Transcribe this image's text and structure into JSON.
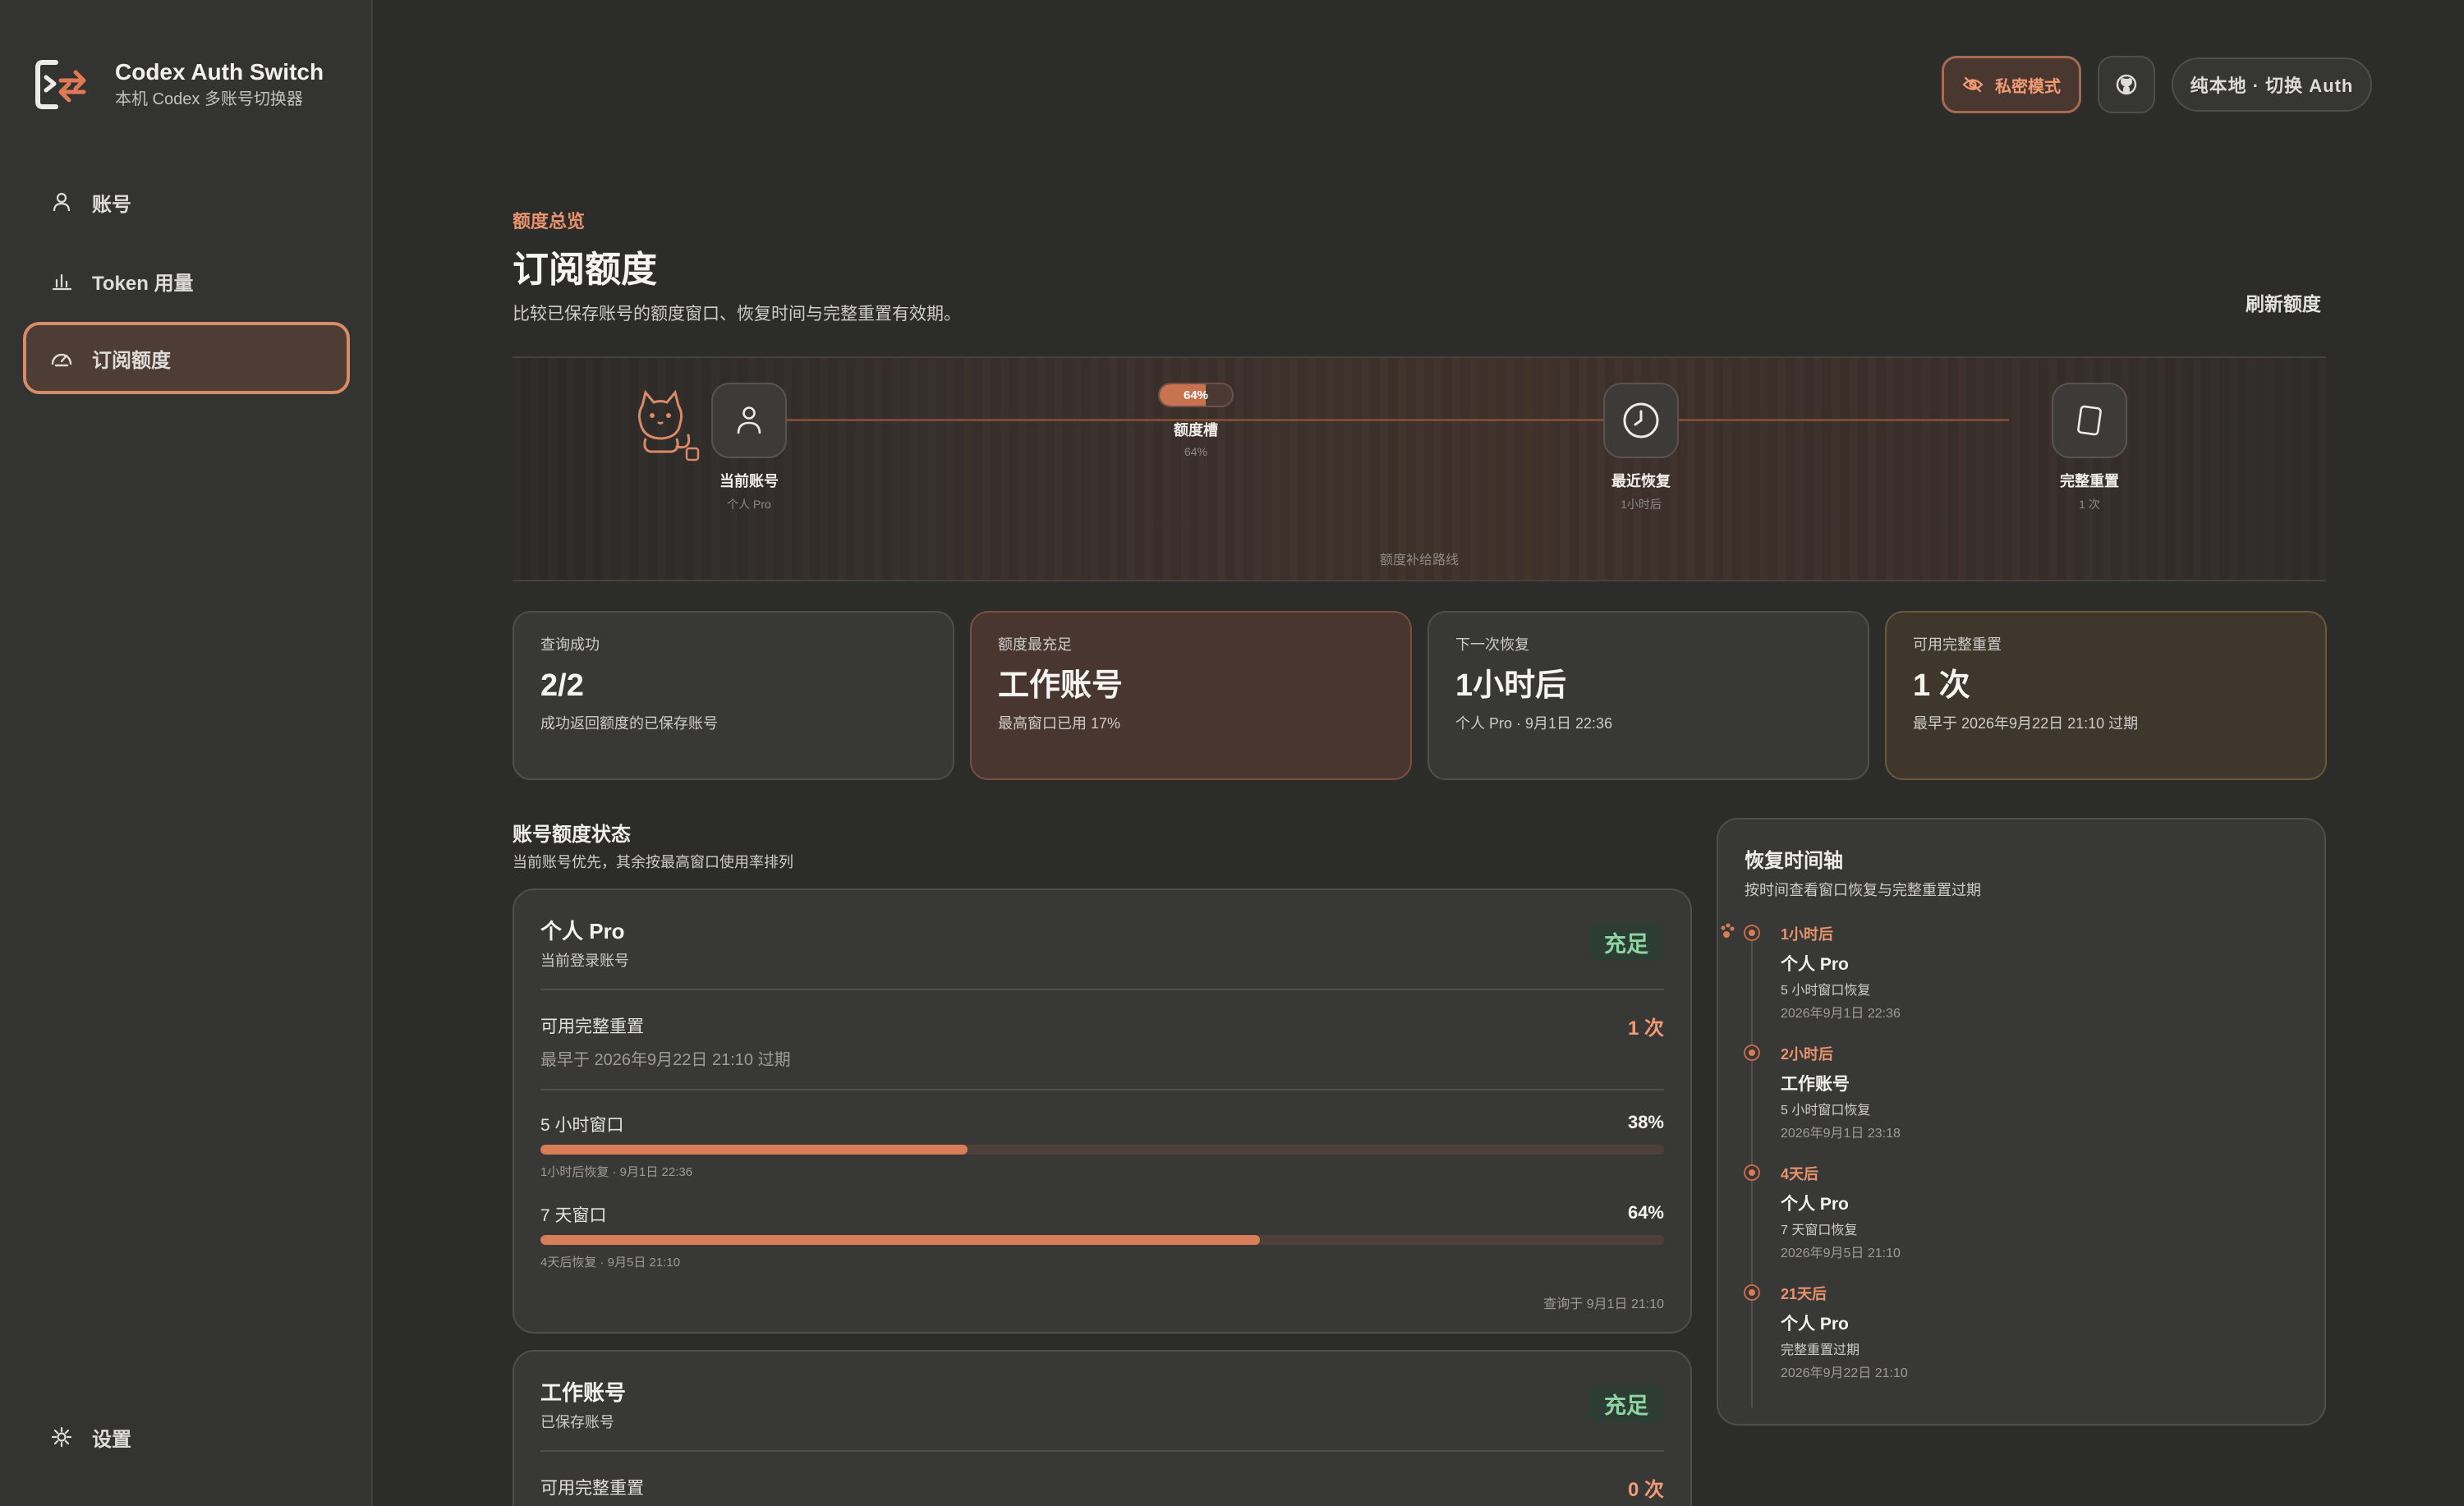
{
  "brand": {
    "title": "Codex Auth Switch",
    "subtitle": "本机 Codex 多账号切换器"
  },
  "nav": {
    "items": [
      {
        "label": "账号",
        "icon": "user-icon"
      },
      {
        "label": "Token 用量",
        "icon": "bar-chart-icon"
      },
      {
        "label": "订阅额度",
        "icon": "gauge-icon",
        "active": true
      }
    ],
    "settings_label": "设置"
  },
  "topbar": {
    "private_label": "私密模式",
    "local_label": "纯本地 · 切换 Auth"
  },
  "header": {
    "eyebrow": "额度总览",
    "title": "订阅额度",
    "description": "比较已保存账号的额度窗口、恢复时间与完整重置有效期。",
    "refresh_label": "刷新额度"
  },
  "route": {
    "caption": "额度补给路线",
    "nodes": [
      {
        "label": "当前账号",
        "sub": "个人 Pro",
        "icon": "user-icon"
      },
      {
        "label": "额度槽",
        "sub": "64%",
        "meter_text": "64%",
        "meter_fraction": 0.64
      },
      {
        "label": "最近恢复",
        "sub": "1小时后",
        "icon": "clock-icon"
      },
      {
        "label": "完整重置",
        "sub": "1 次",
        "icon": "card-icon"
      }
    ]
  },
  "stats": [
    {
      "label": "查询成功",
      "value": "2/2",
      "note": "成功返回额度的已保存账号"
    },
    {
      "label": "额度最充足",
      "value": "工作账号",
      "note": "最高窗口已用 17%"
    },
    {
      "label": "下一次恢复",
      "value": "1小时后",
      "note": "个人 Pro · 9月1日 22:36"
    },
    {
      "label": "可用完整重置",
      "value": "1 次",
      "note": "最早于 2026年9月22日 21:10 过期"
    }
  ],
  "accounts_section": {
    "title": "账号额度状态",
    "subtitle": "当前账号优先，其余按最高窗口使用率排列"
  },
  "accounts": [
    {
      "name": "个人 Pro",
      "subtitle": "当前登录账号",
      "badge": "充足",
      "reset_label": "可用完整重置",
      "reset_value": "1 次",
      "reset_expiry": "最早于 2026年9月22日 21:10 过期",
      "windows": [
        {
          "label": "5 小时窗口",
          "percent_text": "38%",
          "fraction": 0.38,
          "recovery": "1小时后恢复 · 9月1日 22:36"
        },
        {
          "label": "7 天窗口",
          "percent_text": "64%",
          "fraction": 0.64,
          "recovery": "4天后恢复 · 9月5日 21:10"
        }
      ],
      "queried_at": "查询于 9月1日 21:10"
    },
    {
      "name": "工作账号",
      "subtitle": "已保存账号",
      "badge": "充足",
      "reset_label": "可用完整重置",
      "reset_value": "0 次"
    }
  ],
  "timeline": {
    "title": "恢复时间轴",
    "subtitle": "按时间查看窗口恢复与完整重置过期",
    "events": [
      {
        "when": "1小时后",
        "account": "个人 Pro",
        "kind": "5 小时窗口恢复",
        "time": "2026年9月1日 22:36"
      },
      {
        "when": "2小时后",
        "account": "工作账号",
        "kind": "5 小时窗口恢复",
        "time": "2026年9月1日 23:18"
      },
      {
        "when": "4天后",
        "account": "个人 Pro",
        "kind": "7 天窗口恢复",
        "time": "2026年9月5日 21:10"
      },
      {
        "when": "21天后",
        "account": "个人 Pro",
        "kind": "完整重置过期",
        "time": "2026年9月22日 21:10"
      }
    ]
  },
  "colors": {
    "accent": "#e8936c",
    "bar_fill": "#d97c58",
    "ok_badge": "#8fd4a3",
    "background": "#2c2c2b",
    "sidebar": "#333432"
  }
}
